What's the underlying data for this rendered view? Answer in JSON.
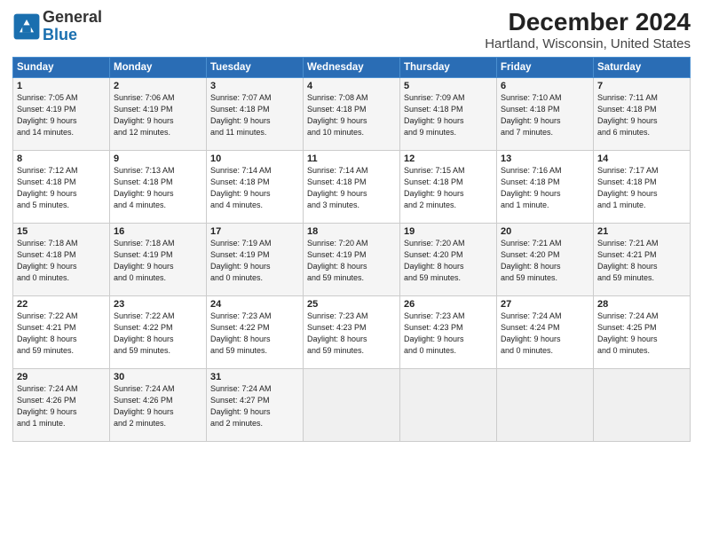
{
  "logo": {
    "line1": "General",
    "line2": "Blue"
  },
  "title": "December 2024",
  "subtitle": "Hartland, Wisconsin, United States",
  "headers": [
    "Sunday",
    "Monday",
    "Tuesday",
    "Wednesday",
    "Thursday",
    "Friday",
    "Saturday"
  ],
  "weeks": [
    [
      {
        "day": "1",
        "info": "Sunrise: 7:05 AM\nSunset: 4:19 PM\nDaylight: 9 hours\nand 14 minutes."
      },
      {
        "day": "2",
        "info": "Sunrise: 7:06 AM\nSunset: 4:19 PM\nDaylight: 9 hours\nand 12 minutes."
      },
      {
        "day": "3",
        "info": "Sunrise: 7:07 AM\nSunset: 4:18 PM\nDaylight: 9 hours\nand 11 minutes."
      },
      {
        "day": "4",
        "info": "Sunrise: 7:08 AM\nSunset: 4:18 PM\nDaylight: 9 hours\nand 10 minutes."
      },
      {
        "day": "5",
        "info": "Sunrise: 7:09 AM\nSunset: 4:18 PM\nDaylight: 9 hours\nand 9 minutes."
      },
      {
        "day": "6",
        "info": "Sunrise: 7:10 AM\nSunset: 4:18 PM\nDaylight: 9 hours\nand 7 minutes."
      },
      {
        "day": "7",
        "info": "Sunrise: 7:11 AM\nSunset: 4:18 PM\nDaylight: 9 hours\nand 6 minutes."
      }
    ],
    [
      {
        "day": "8",
        "info": "Sunrise: 7:12 AM\nSunset: 4:18 PM\nDaylight: 9 hours\nand 5 minutes."
      },
      {
        "day": "9",
        "info": "Sunrise: 7:13 AM\nSunset: 4:18 PM\nDaylight: 9 hours\nand 4 minutes."
      },
      {
        "day": "10",
        "info": "Sunrise: 7:14 AM\nSunset: 4:18 PM\nDaylight: 9 hours\nand 4 minutes."
      },
      {
        "day": "11",
        "info": "Sunrise: 7:14 AM\nSunset: 4:18 PM\nDaylight: 9 hours\nand 3 minutes."
      },
      {
        "day": "12",
        "info": "Sunrise: 7:15 AM\nSunset: 4:18 PM\nDaylight: 9 hours\nand 2 minutes."
      },
      {
        "day": "13",
        "info": "Sunrise: 7:16 AM\nSunset: 4:18 PM\nDaylight: 9 hours\nand 1 minute."
      },
      {
        "day": "14",
        "info": "Sunrise: 7:17 AM\nSunset: 4:18 PM\nDaylight: 9 hours\nand 1 minute."
      }
    ],
    [
      {
        "day": "15",
        "info": "Sunrise: 7:18 AM\nSunset: 4:18 PM\nDaylight: 9 hours\nand 0 minutes."
      },
      {
        "day": "16",
        "info": "Sunrise: 7:18 AM\nSunset: 4:19 PM\nDaylight: 9 hours\nand 0 minutes."
      },
      {
        "day": "17",
        "info": "Sunrise: 7:19 AM\nSunset: 4:19 PM\nDaylight: 9 hours\nand 0 minutes."
      },
      {
        "day": "18",
        "info": "Sunrise: 7:20 AM\nSunset: 4:19 PM\nDaylight: 8 hours\nand 59 minutes."
      },
      {
        "day": "19",
        "info": "Sunrise: 7:20 AM\nSunset: 4:20 PM\nDaylight: 8 hours\nand 59 minutes."
      },
      {
        "day": "20",
        "info": "Sunrise: 7:21 AM\nSunset: 4:20 PM\nDaylight: 8 hours\nand 59 minutes."
      },
      {
        "day": "21",
        "info": "Sunrise: 7:21 AM\nSunset: 4:21 PM\nDaylight: 8 hours\nand 59 minutes."
      }
    ],
    [
      {
        "day": "22",
        "info": "Sunrise: 7:22 AM\nSunset: 4:21 PM\nDaylight: 8 hours\nand 59 minutes."
      },
      {
        "day": "23",
        "info": "Sunrise: 7:22 AM\nSunset: 4:22 PM\nDaylight: 8 hours\nand 59 minutes."
      },
      {
        "day": "24",
        "info": "Sunrise: 7:23 AM\nSunset: 4:22 PM\nDaylight: 8 hours\nand 59 minutes."
      },
      {
        "day": "25",
        "info": "Sunrise: 7:23 AM\nSunset: 4:23 PM\nDaylight: 8 hours\nand 59 minutes."
      },
      {
        "day": "26",
        "info": "Sunrise: 7:23 AM\nSunset: 4:23 PM\nDaylight: 9 hours\nand 0 minutes."
      },
      {
        "day": "27",
        "info": "Sunrise: 7:24 AM\nSunset: 4:24 PM\nDaylight: 9 hours\nand 0 minutes."
      },
      {
        "day": "28",
        "info": "Sunrise: 7:24 AM\nSunset: 4:25 PM\nDaylight: 9 hours\nand 0 minutes."
      }
    ],
    [
      {
        "day": "29",
        "info": "Sunrise: 7:24 AM\nSunset: 4:26 PM\nDaylight: 9 hours\nand 1 minute."
      },
      {
        "day": "30",
        "info": "Sunrise: 7:24 AM\nSunset: 4:26 PM\nDaylight: 9 hours\nand 2 minutes."
      },
      {
        "day": "31",
        "info": "Sunrise: 7:24 AM\nSunset: 4:27 PM\nDaylight: 9 hours\nand 2 minutes."
      },
      null,
      null,
      null,
      null
    ]
  ]
}
